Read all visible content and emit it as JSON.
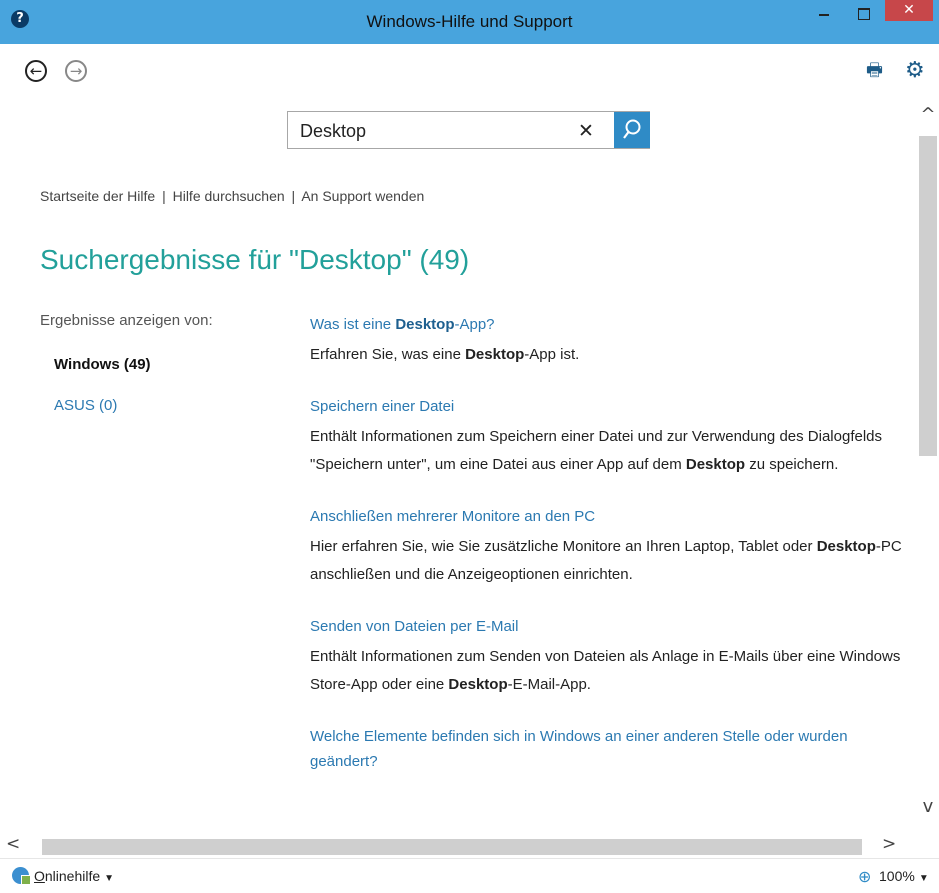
{
  "window": {
    "title": "Windows-Hilfe und Support",
    "help_badge": "?",
    "close_glyph": "✕"
  },
  "toolbar": {
    "back_glyph": "←",
    "forward_glyph": "→",
    "print_icon": "print-icon",
    "settings_icon": "gear-icon"
  },
  "search": {
    "value": "Desktop",
    "clear_glyph": "✕"
  },
  "links": {
    "home": "Startseite der Hilfe",
    "browse": "Hilfe durchsuchen",
    "contact": "An Support wenden",
    "separator": "|"
  },
  "heading": "Suchergebnisse für \"Desktop\" (49)",
  "sidebar": {
    "label": "Ergebnisse anzeigen von:",
    "facets": [
      {
        "label": "Windows (49)",
        "selected": true
      },
      {
        "label": "ASUS (0)",
        "selected": false
      }
    ]
  },
  "results": [
    {
      "title_pre": "Was ist eine ",
      "title_bold": "Desktop",
      "title_post": "-App?",
      "desc_pre": "Erfahren Sie, was eine ",
      "desc_bold": "Desktop",
      "desc_post": "-App ist."
    },
    {
      "title_pre": "Speichern einer Datei",
      "title_bold": "",
      "title_post": "",
      "desc_pre": "Enthält Informationen zum Speichern einer Datei und zur Verwendung des Dialogfelds \"Speichern unter\", um eine Datei aus einer App auf dem ",
      "desc_bold": "Desktop",
      "desc_post": " zu speichern."
    },
    {
      "title_pre": "Anschließen mehrerer Monitore an den PC",
      "title_bold": "",
      "title_post": "",
      "desc_pre": "Hier erfahren Sie, wie Sie zusätzliche Monitore an Ihren Laptop, Tablet oder ",
      "desc_bold": "Desktop",
      "desc_post": "-PC anschließen und die Anzeigeoptionen einrichten."
    },
    {
      "title_pre": "Senden von Dateien per E-Mail",
      "title_bold": "",
      "title_post": "",
      "desc_pre": "Enthält Informationen zum Senden von Dateien als Anlage in E-Mails über eine Windows Store-App oder eine ",
      "desc_bold": "Desktop",
      "desc_post": "-E-Mail-App."
    },
    {
      "title_pre": "Welche Elemente befinden sich in Windows an einer anderen Stelle oder wurden geändert?",
      "title_bold": "",
      "title_post": "",
      "desc_pre": "",
      "desc_bold": "",
      "desc_post": ""
    }
  ],
  "scrollbars": {
    "up_glyph": "^",
    "down_glyph": "v",
    "left_glyph": "<",
    "right_glyph": ">"
  },
  "status": {
    "online_help_prefix": "O",
    "online_help_rest": "nlinehilfe",
    "caret": "▼",
    "zoom": "100%"
  },
  "colors": {
    "titlebar": "#48a4dd",
    "accent_link": "#2b79b1",
    "heading": "#22a09a",
    "search_button": "#2f8bc6",
    "close_button": "#c7474a"
  }
}
